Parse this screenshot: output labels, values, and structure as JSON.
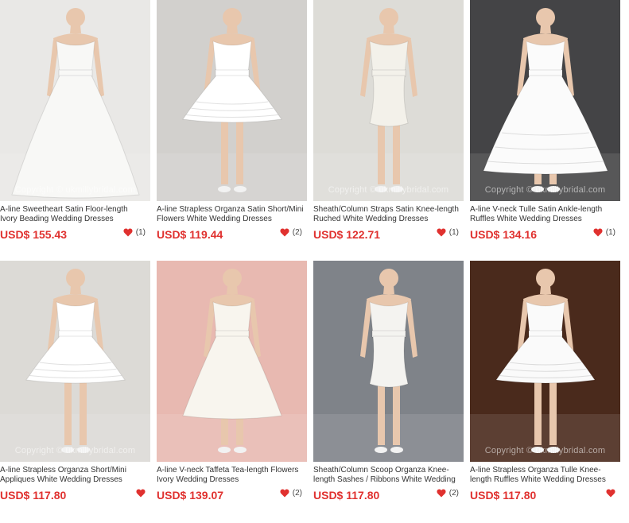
{
  "colors": {
    "price": "#e0312f",
    "heart": "#e0312f",
    "title": "#333333"
  },
  "products": [
    {
      "title": "A-line Sweetheart Satin Floor-length Ivory Beading Wedding Dresses",
      "price": "USD$ 155.43",
      "rating": "(1)",
      "copyright": "Copyright © ukmillybridal.com",
      "bg": "#e9e8e6",
      "dress": "#f8f8f6",
      "shape": "long"
    },
    {
      "title": "A-line Strapless Organza Satin Short/Mini Flowers White Wedding Dresses",
      "price": "USD$ 119.44",
      "rating": "(2)",
      "copyright": "",
      "bg": "#d2d0cd",
      "dress": "#ffffff",
      "shape": "short"
    },
    {
      "title": "Sheath/Column Straps Satin Knee-length Ruched White Wedding Dresses",
      "price": "USD$ 122.71",
      "rating": "(1)",
      "copyright": "Copyright © ukmillybridal.com",
      "bg": "#dddcd7",
      "dress": "#f3f1ea",
      "shape": "sheath"
    },
    {
      "title": "A-line V-neck Tulle Satin Ankle-length Ruffles White Wedding Dresses",
      "price": "USD$ 134.16",
      "rating": "(1)",
      "copyright": "Copyright © ukmillybridal.com",
      "bg": "#444446",
      "dress": "#fbfbfb",
      "shape": "ankle"
    },
    {
      "title": "A-line Strapless Organza Short/Mini Appliques White Wedding Dresses",
      "price": "USD$ 117.80",
      "rating": "",
      "copyright": "Copyright © ukmillybridal.com",
      "bg": "#dcdad6",
      "dress": "#ffffff",
      "shape": "short"
    },
    {
      "title": "A-line V-neck Taffeta Tea-length Flowers Ivory Wedding Dresses",
      "price": "USD$ 139.07",
      "rating": "(2)",
      "copyright": "",
      "bg": "#e8b9b1",
      "dress": "#f8f5ee",
      "shape": "tea"
    },
    {
      "title": "Sheath/Column Scoop Organza Knee-length Sashes / Ribbons White Wedding Dresses",
      "price": "USD$ 117.80",
      "rating": "(2)",
      "copyright": "",
      "bg": "#7f8389",
      "dress": "#f4f3f0",
      "shape": "sheath"
    },
    {
      "title": "A-line Strapless Organza Tulle Knee-length Ruffles White Wedding Dresses",
      "price": "USD$ 117.80",
      "rating": "",
      "copyright": "Copyright © ukmillybridal.com",
      "bg": "#4a2a1c",
      "dress": "#fafafa",
      "shape": "short"
    }
  ]
}
